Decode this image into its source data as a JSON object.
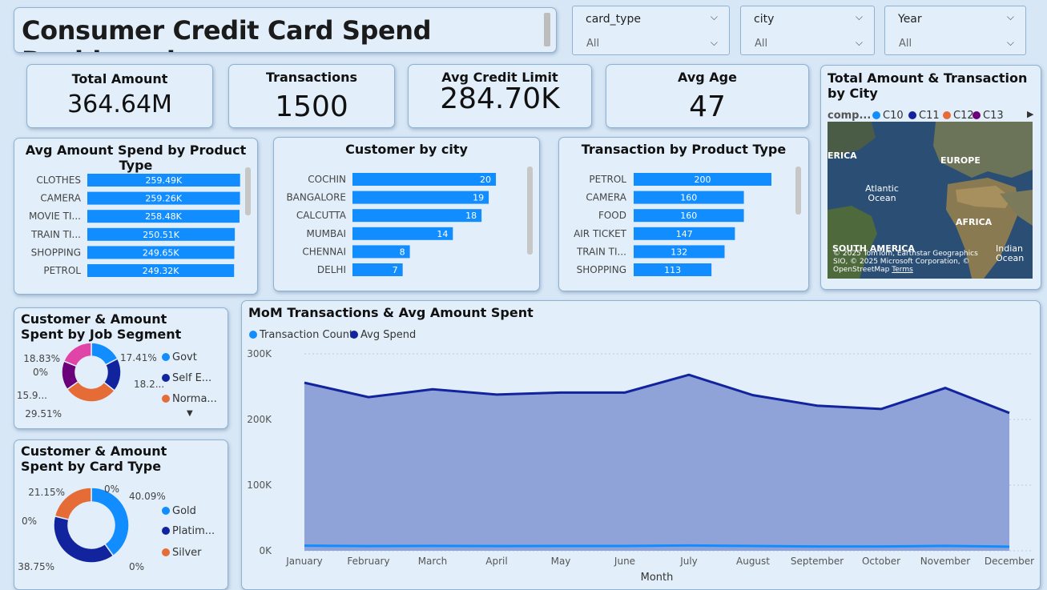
{
  "header": {
    "title": "Consumer Credit Card Spend Dashboard"
  },
  "filters": [
    {
      "label": "card_type",
      "value": "All"
    },
    {
      "label": "city",
      "value": "All"
    },
    {
      "label": "Year",
      "value": "All"
    }
  ],
  "kpis": [
    {
      "title": "Total Amount",
      "value": "364.64M"
    },
    {
      "title": "Transactions",
      "value": "1500"
    },
    {
      "title": "Avg Credit Limit",
      "value": "284.70K"
    },
    {
      "title": "Avg Age",
      "value": "47"
    }
  ],
  "map_card": {
    "title": "Total Amount & Transaction by City",
    "legend_label": "comp...",
    "legend_items": [
      {
        "name": "C10",
        "color": "#118dff"
      },
      {
        "name": "C11",
        "color": "#12239e"
      },
      {
        "name": "C12",
        "color": "#e66c37"
      },
      {
        "name": "C13",
        "color": "#6b007b"
      }
    ],
    "labels": [
      "ERICA",
      "EUROPE",
      "Atlantic Ocean",
      "AFRICA",
      "SOUTH AMERICA",
      "Indian Ocean"
    ],
    "copyright": "© 2025 TomTom, Earthstar Geographics SIO, © 2025 Microsoft Corporation, © OpenStreetMap",
    "terms": "Terms"
  },
  "chart_data": [
    {
      "type": "bar",
      "title": "Avg Amount Spend by Product Type",
      "categories": [
        "CLOTHES",
        "CAMERA",
        "MOVIE TI...",
        "TRAIN TI...",
        "SHOPPING",
        "PETROL"
      ],
      "values": [
        259490,
        259260,
        258480,
        250510,
        249650,
        249320
      ],
      "labels": [
        "259.49K",
        "259.26K",
        "258.48K",
        "250.51K",
        "249.65K",
        "249.32K"
      ],
      "xlim": [
        0,
        400000
      ],
      "color": "#118dff"
    },
    {
      "type": "bar",
      "title": "Customer by city",
      "categories": [
        "COCHIN",
        "BANGALORE",
        "CALCUTTA",
        "MUMBAI",
        "CHENNAI",
        "DELHI"
      ],
      "values": [
        20,
        19,
        18,
        14,
        8,
        7
      ],
      "labels": [
        "20",
        "19",
        "18",
        "14",
        "8",
        "7"
      ],
      "xlim": [
        0,
        21
      ],
      "color": "#118dff"
    },
    {
      "type": "bar",
      "title": "Transaction by Product Type",
      "categories": [
        "PETROL",
        "CAMERA",
        "FOOD",
        "AIR TICKET",
        "TRAIN TI...",
        "SHOPPING"
      ],
      "values": [
        200,
        160,
        160,
        147,
        132,
        113
      ],
      "labels": [
        "200",
        "160",
        "160",
        "147",
        "132",
        "113"
      ],
      "xlim": [
        0,
        200
      ],
      "color": "#118dff"
    },
    {
      "type": "pie",
      "title": "Customer & Amount Spent by Job Segment",
      "slices": [
        {
          "label": "17.41%",
          "value": 17.41,
          "color": "#118dff"
        },
        {
          "label": "18.2...",
          "value": 18.25,
          "color": "#12239e"
        },
        {
          "label": "29.51%",
          "value": 29.51,
          "color": "#e66c37"
        },
        {
          "label": "15.9...",
          "value": 15.99,
          "color": "#6b007b"
        },
        {
          "label": "0%",
          "value": 0,
          "color": "#e044a7"
        },
        {
          "label": "18.83%",
          "value": 18.83,
          "color": "#e044a7"
        }
      ],
      "legend": [
        {
          "name": "Govt",
          "color": "#118dff"
        },
        {
          "name": "Self E...",
          "color": "#12239e"
        },
        {
          "name": "Norma...",
          "color": "#e66c37"
        }
      ]
    },
    {
      "type": "pie",
      "title": "Customer & Amount Spent by Card Type",
      "slices": [
        {
          "label": "40.09%",
          "value": 40.09,
          "color": "#118dff"
        },
        {
          "label": "0%",
          "value": 0,
          "color": "#118dff"
        },
        {
          "label": "38.75%",
          "value": 38.75,
          "color": "#12239e"
        },
        {
          "label": "0%",
          "value": 0,
          "color": "#12239e"
        },
        {
          "label": "21.15%",
          "value": 21.15,
          "color": "#e66c37"
        },
        {
          "label": "0%",
          "value": 0,
          "color": "#e66c37"
        }
      ],
      "legend": [
        {
          "name": "Gold",
          "color": "#118dff"
        },
        {
          "name": "Platim...",
          "color": "#12239e"
        },
        {
          "name": "Silver",
          "color": "#e66c37"
        }
      ]
    },
    {
      "type": "area",
      "title": "MoM Transactions & Avg Amount Spent",
      "x": [
        "January",
        "February",
        "March",
        "April",
        "May",
        "June",
        "July",
        "August",
        "September",
        "October",
        "November",
        "December"
      ],
      "series": [
        {
          "name": "Transaction Count",
          "color": "#118dff",
          "values": [
            130,
            120,
            125,
            120,
            122,
            123,
            135,
            121,
            110,
            108,
            125,
            105
          ]
        },
        {
          "name": "Avg Spend",
          "color": "#12239e",
          "values": [
            256000,
            234000,
            246000,
            238000,
            241000,
            241000,
            268000,
            237000,
            221000,
            216000,
            248000,
            210000
          ]
        }
      ],
      "xlabel": "Month",
      "ylabel": "",
      "ylim": [
        0,
        300000
      ],
      "yticks": [
        "0K",
        "100K",
        "200K",
        "300K"
      ],
      "area_fill": "#8b9ed6",
      "grid": true
    }
  ]
}
